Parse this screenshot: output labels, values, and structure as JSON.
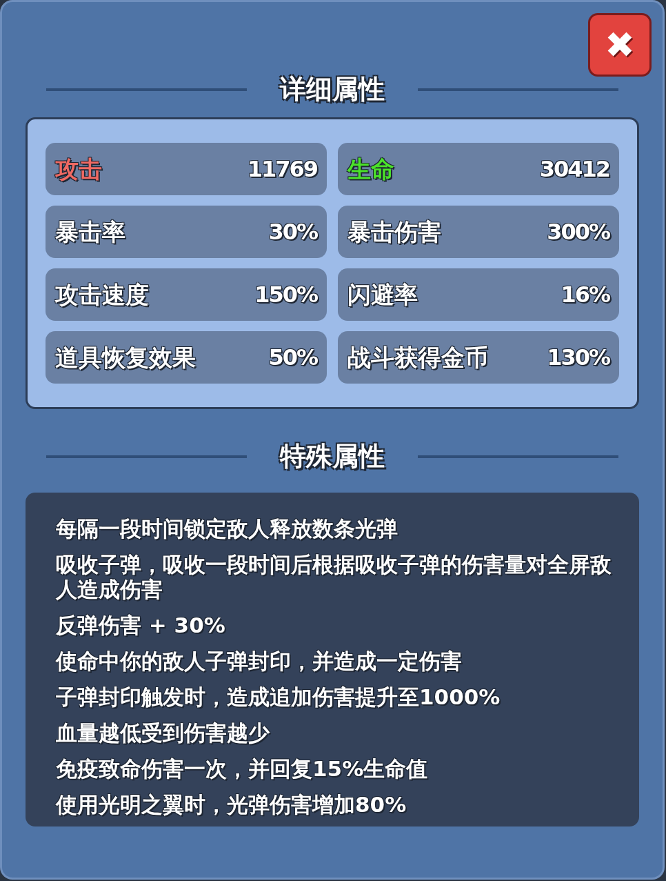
{
  "close_button": {
    "label": "✖"
  },
  "sections": [
    {
      "title": "详细属性"
    },
    {
      "title": "特殊属性"
    }
  ],
  "stats": [
    {
      "label": "攻击",
      "value": "11769",
      "color": "#f06a63"
    },
    {
      "label": "生命",
      "value": "30412",
      "color": "#4be22a"
    },
    {
      "label": "暴击率",
      "value": "30%",
      "color": "#ffffff"
    },
    {
      "label": "暴击伤害",
      "value": "300%",
      "color": "#ffffff"
    },
    {
      "label": "攻击速度",
      "value": "150%",
      "color": "#ffffff"
    },
    {
      "label": "闪避率",
      "value": "16%",
      "color": "#ffffff"
    },
    {
      "label": "道具恢复效果",
      "value": "50%",
      "color": "#ffffff"
    },
    {
      "label": "战斗获得金币",
      "value": "130%",
      "color": "#ffffff"
    }
  ],
  "special_attributes": [
    "每隔一段时间锁定敌人释放数条光弹",
    "吸收子弹，吸收一段时间后根据吸收子弹的伤害量对全屏敌人造成伤害",
    "反弹伤害 + 30%",
    "使命中你的敌人子弹封印，并造成一定伤害",
    "子弹封印触发时，造成追加伤害提升至1000%",
    "血量越低受到伤害越少",
    "免疫致命伤害一次，并回复15%生命值",
    "使用光明之翼时，光弹伤害增加80%"
  ]
}
